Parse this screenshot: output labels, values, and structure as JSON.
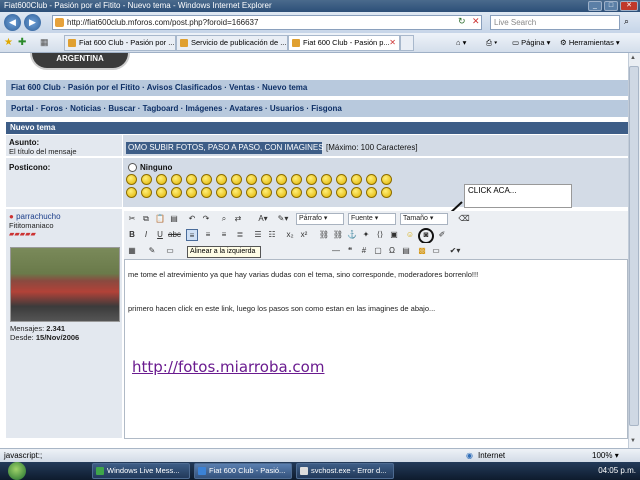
{
  "window": {
    "title": "Fiat600Club - Pasión por el Fitito - Nuevo tema - Windows Internet Explorer"
  },
  "addressbar": {
    "url": "http://fiat600club.mforos.com/post.php?foroid=166637",
    "search_placeholder": "Live Search"
  },
  "tabs": [
    {
      "label": "Fiat 600 Club - Pasión por ..."
    },
    {
      "label": "Servicio de publicación de ..."
    },
    {
      "label": "Fiat 600 Club - Pasión p..."
    }
  ],
  "toolbar_right": {
    "page": "Página",
    "tools": "Herramientas"
  },
  "site": {
    "logo_text": "ARGENTINA",
    "nav1": "Fiat 600 Club · Pasión por el Fitito · Avisos Clasificados · Ventas · Nuevo tema",
    "nav2": "Portal · Foros · Noticias · Buscar · Tagboard · Imágenes · Avatares · Usuarios · Fisgona",
    "section_header": "Nuevo tema"
  },
  "form": {
    "subject_label": "Asunto:",
    "subject_sub": "El título del mensaje",
    "subject_value": "OMO SUBIR FOTOS, PASO A PASO, CON IMAGINES",
    "max_chars": "[Máximo: 100 Caracteres]",
    "posticon_label": "Posticono:",
    "posticon_none": "Ninguno"
  },
  "user": {
    "name": "parrachucho",
    "rank": "Fititomaniaco",
    "posts_label": "Mensajes:",
    "posts": "2.341",
    "since_label": "Desde:",
    "since": "15/Nov/2006"
  },
  "editor_toolbar": {
    "paragraph": "Párrafo",
    "font": "Fuente",
    "size": "Tamaño",
    "tooltip": "Alinear a la izquierda"
  },
  "callout": {
    "text": "CLICK ACA..."
  },
  "editor_content": {
    "line1": "me tome el atrevimiento ya que hay varias dudas con el tema, sino corresponde, moderadores borrenlo!!!",
    "line2": "primero hacen click en este link, luego los pasos son como estan en las imagines de abajo...",
    "link": "http://fotos.miarroba.com"
  },
  "statusbar": {
    "left": "javascript:;",
    "zone": "Internet",
    "zoom": "100%"
  },
  "taskbar": {
    "items": [
      {
        "label": "Windows Live Mess..."
      },
      {
        "label": "Fiat 600 Club - Pasió..."
      },
      {
        "label": "svchost.exe - Error d..."
      }
    ],
    "clock": "04:05 p.m."
  },
  "colors": {
    "accent": "#3d5d87",
    "nav_bg": "#b8c9dd",
    "link": "#6a1b8f"
  }
}
